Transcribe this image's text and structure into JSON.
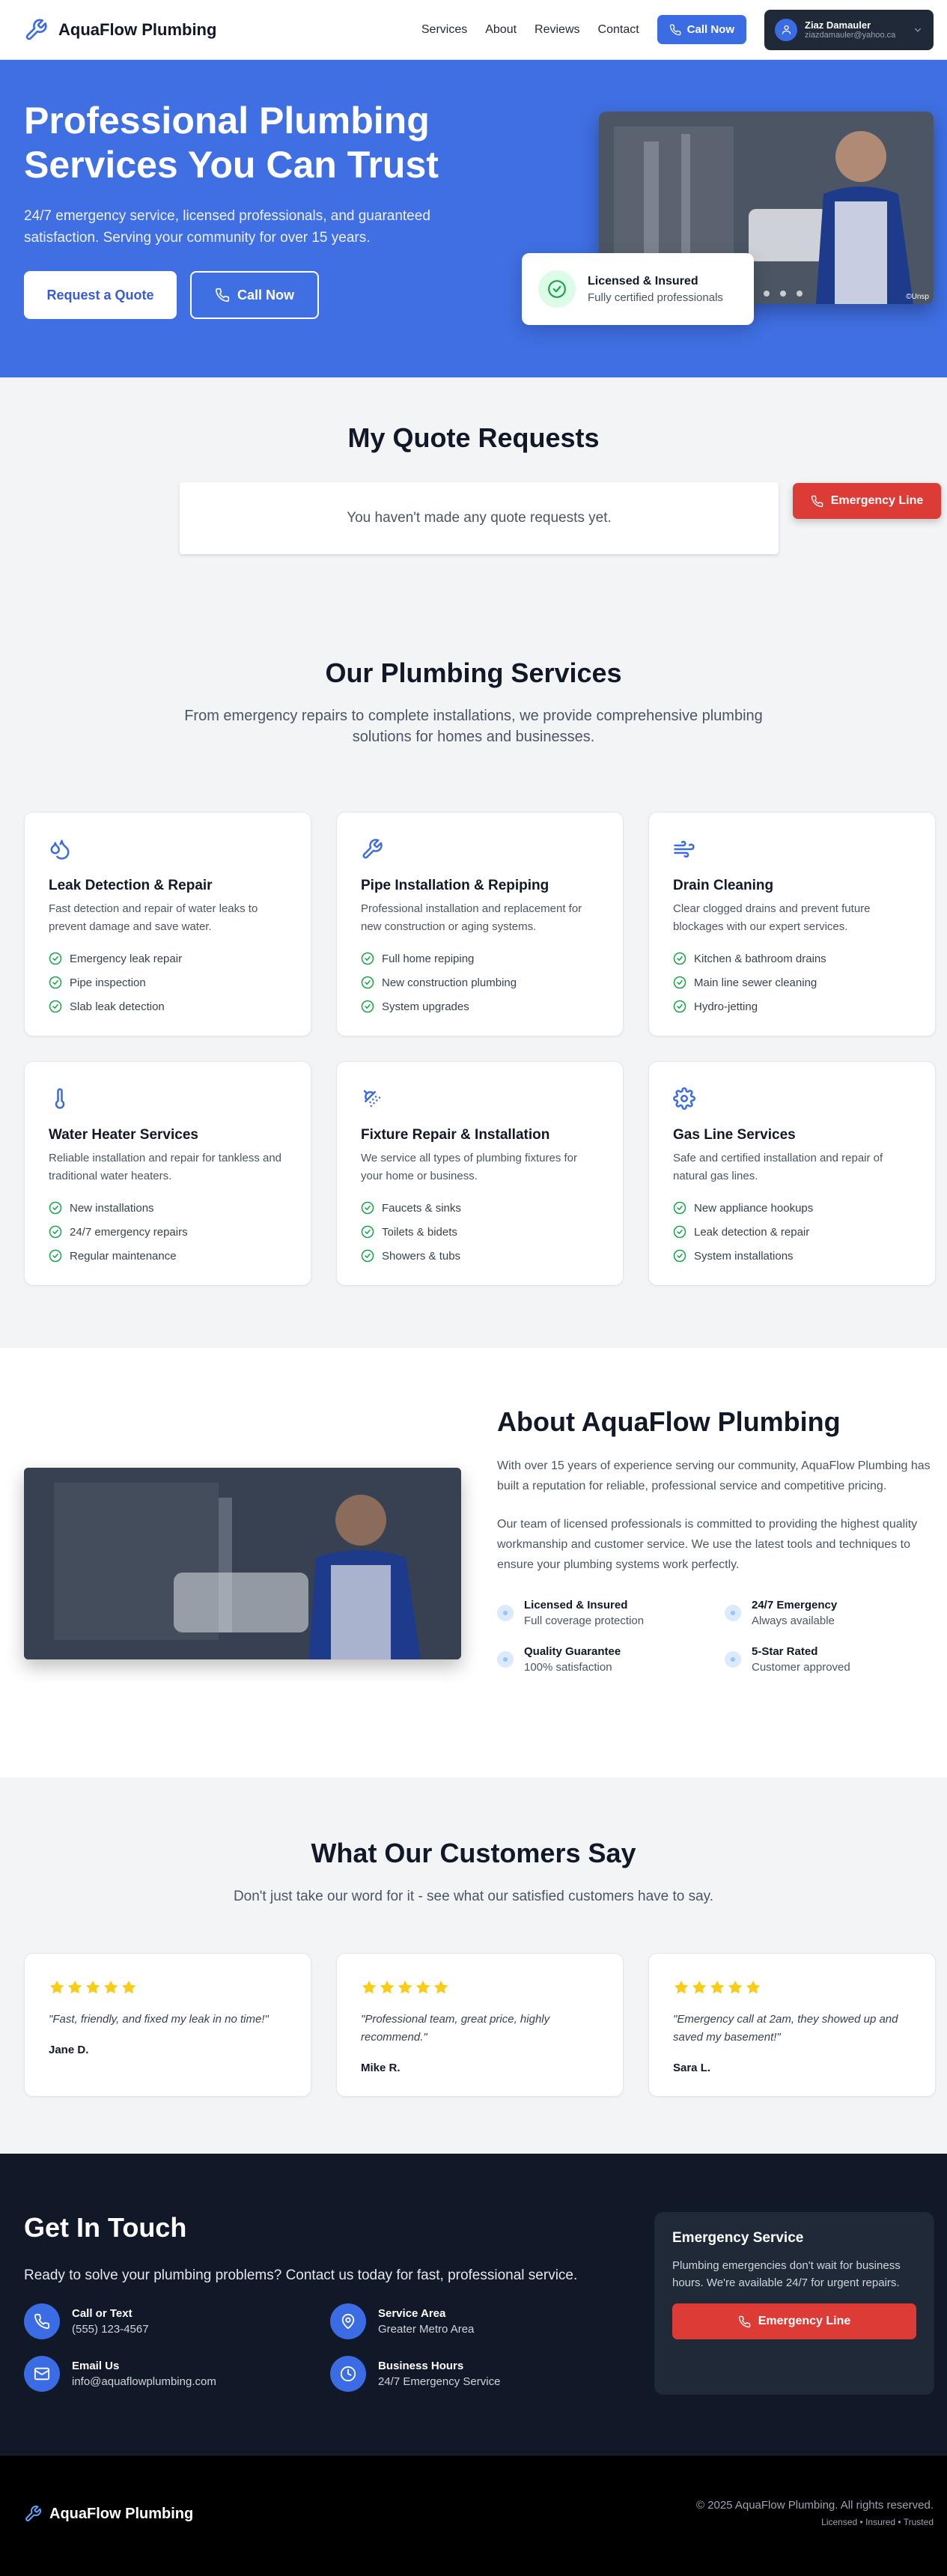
{
  "brand": {
    "name": "AquaFlow Plumbing",
    "accent": "#3b6ce4",
    "emergency_color": "#dc3b36"
  },
  "nav": {
    "links": [
      "Services",
      "About",
      "Reviews",
      "Contact"
    ],
    "call_label": "Call Now",
    "user": {
      "name": "Ziaz Damauler",
      "email": "ziazdamauler@yahoo.ca"
    }
  },
  "hero": {
    "title": "Professional Plumbing Services You Can Trust",
    "subtitle": "24/7 emergency service, licensed professionals, and guaranteed satisfaction. Serving your community for over 15 years.",
    "quote_button": "Request a Quote",
    "call_button": "Call Now",
    "image_credit": "©Unsp",
    "badge": {
      "title": "Licensed & Insured",
      "subtitle": "Fully certified professionals"
    }
  },
  "quotes": {
    "title": "My Quote Requests",
    "empty": "You haven't made any quote requests yet.",
    "emergency_button": "Emergency Line"
  },
  "services": {
    "title": "Our Plumbing Services",
    "subtitle": "From emergency repairs to complete installations, we provide comprehensive plumbing solutions for homes and businesses.",
    "items": [
      {
        "icon": "droplets-icon",
        "title": "Leak Detection & Repair",
        "desc": "Fast detection and repair of water leaks to prevent damage and save water.",
        "features": [
          "Emergency leak repair",
          "Pipe inspection",
          "Slab leak detection"
        ]
      },
      {
        "icon": "wrench-icon",
        "title": "Pipe Installation & Repiping",
        "desc": "Professional installation and replacement for new construction or aging systems.",
        "features": [
          "Full home repiping",
          "New construction plumbing",
          "System upgrades"
        ]
      },
      {
        "icon": "wind-icon",
        "title": "Drain Cleaning",
        "desc": "Clear clogged drains and prevent future blockages with our expert services.",
        "features": [
          "Kitchen & bathroom drains",
          "Main line sewer cleaning",
          "Hydro-jetting"
        ]
      },
      {
        "icon": "thermometer-icon",
        "title": "Water Heater Services",
        "desc": "Reliable installation and repair for tankless and traditional water heaters.",
        "features": [
          "New installations",
          "24/7 emergency repairs",
          "Regular maintenance"
        ]
      },
      {
        "icon": "shower-head-icon",
        "title": "Fixture Repair & Installation",
        "desc": "We service all types of plumbing fixtures for your home or business.",
        "features": [
          "Faucets & sinks",
          "Toilets & bidets",
          "Showers & tubs"
        ]
      },
      {
        "icon": "gear-icon",
        "title": "Gas Line Services",
        "desc": "Safe and certified installation and repair of natural gas lines.",
        "features": [
          "New appliance hookups",
          "Leak detection & repair",
          "System installations"
        ]
      }
    ]
  },
  "about": {
    "title": "About AquaFlow Plumbing",
    "p1": "With over 15 years of experience serving our community, AquaFlow Plumbing has built a reputation for reliable, professional service and competitive pricing.",
    "p2": "Our team of licensed professionals is committed to providing the highest quality workmanship and customer service. We use the latest tools and techniques to ensure your plumbing systems work perfectly.",
    "features": [
      {
        "title": "Licensed & Insured",
        "sub": "Full coverage protection"
      },
      {
        "title": "24/7 Emergency",
        "sub": "Always available"
      },
      {
        "title": "Quality Guarantee",
        "sub": "100% satisfaction"
      },
      {
        "title": "5-Star Rated",
        "sub": "Customer approved"
      }
    ]
  },
  "testimonials": {
    "title": "What Our Customers Say",
    "subtitle": "Don't just take our word for it - see what our satisfied customers have to say.",
    "star_color": "#facc15",
    "items": [
      {
        "rating": 5,
        "quote": "\"Fast, friendly, and fixed my leak in no time!\"",
        "author": "Jane D."
      },
      {
        "rating": 5,
        "quote": "\"Professional team, great price, highly recommend.\"",
        "author": "Mike R."
      },
      {
        "rating": 5,
        "quote": "\"Emergency call at 2am, they showed up and saved my basement!\"",
        "author": "Sara L."
      }
    ]
  },
  "contact": {
    "title": "Get In Touch",
    "subtitle": "Ready to solve your plumbing problems? Contact us today for fast, professional service.",
    "items": [
      {
        "icon": "phone-icon",
        "title": "Call or Text",
        "value": "(555) 123-4567"
      },
      {
        "icon": "map-pin-icon",
        "title": "Service Area",
        "value": "Greater Metro Area"
      },
      {
        "icon": "mail-icon",
        "title": "Email Us",
        "value": "info@aquaflowplumbing.com"
      },
      {
        "icon": "clock-icon",
        "title": "Business Hours",
        "value": "24/7 Emergency Service"
      }
    ],
    "emergency": {
      "title": "Emergency Service",
      "text": "Plumbing emergencies don't wait for business hours. We're available 24/7 for urgent repairs.",
      "button": "Emergency Line"
    }
  },
  "footer": {
    "brand": "AquaFlow Plumbing",
    "copyright": "© 2025 AquaFlow Plumbing. All rights reserved.",
    "tagline": "Licensed • Insured • Trusted"
  }
}
